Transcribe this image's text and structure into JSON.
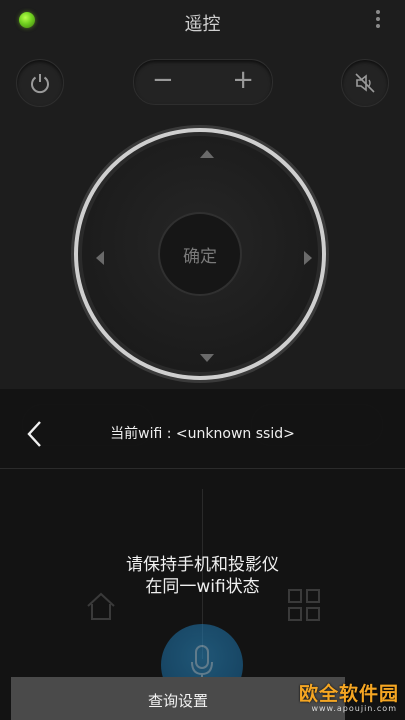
{
  "header": {
    "title": "遥控"
  },
  "volume": {
    "minus": "−",
    "plus": "+"
  },
  "dpad": {
    "ok_label": "确定"
  },
  "overlay": {
    "wifi_text": "当前wifi : <unknown ssid>",
    "message_line1": "请保持手机和投影仪",
    "message_line2": "在同一wifi状态"
  },
  "bottom": {
    "query_label": "查询设置"
  },
  "watermark": {
    "brand": "欧全软件园",
    "url": "www.apoujin.com"
  },
  "colors": {
    "accent_green": "#6fcf1f",
    "mic_blue": "#1b6fa6",
    "watermark_orange": "#f5a623"
  }
}
